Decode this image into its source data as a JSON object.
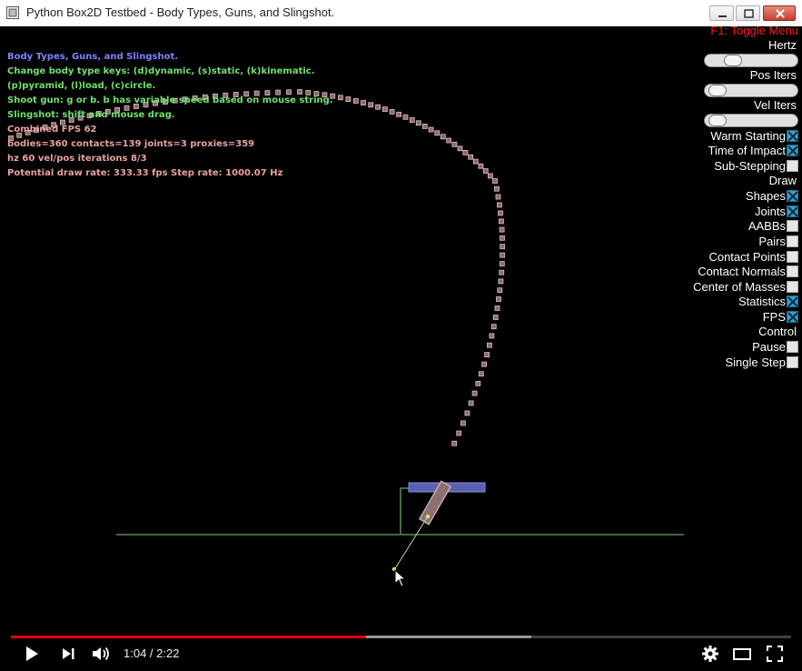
{
  "window": {
    "title": "Python Box2D Testbed - Body Types, Guns, and Slingshot."
  },
  "info": {
    "lines": [
      {
        "text": "Body Types, Guns, and Slingshot.",
        "color": "blue"
      },
      {
        "text": "Change body type keys: (d)dynamic, (s)static, (k)kinematic.",
        "color": "green"
      },
      {
        "text": "(p)pyramid, (l)load, (c)circle.",
        "color": "green"
      },
      {
        "text": "Shoot gun: g or b. b has variable speed based on mouse string.",
        "color": "green"
      },
      {
        "text": "Slingshot: shift and mouse drag.",
        "color": "green"
      },
      {
        "text": "Combined FPS 62",
        "color": "pink"
      },
      {
        "text": "bodies=360 contacts=139 joints=3 proxies=359",
        "color": "pink"
      },
      {
        "text": "hz 60 vel/pos iterations 8/3",
        "color": "pink"
      },
      {
        "text": "Potential draw rate: 333.33 fps Step rate: 1000.07 Hz",
        "color": "pink"
      }
    ]
  },
  "menu": {
    "toggle_label": "F1: Toggle Menu",
    "sliders": [
      {
        "label": "Hertz",
        "value": 0.25
      },
      {
        "label": "Pos Iters",
        "value": 0.05
      },
      {
        "label": "Vel Iters",
        "value": 0.05
      }
    ],
    "options": [
      {
        "label": "Warm Starting",
        "checked": true
      },
      {
        "label": "Time of Impact",
        "checked": true
      },
      {
        "label": "Sub-Stepping",
        "checked": false
      }
    ],
    "draw_header": "Draw",
    "draw_options": [
      {
        "label": "Shapes",
        "checked": true
      },
      {
        "label": "Joints",
        "checked": true
      },
      {
        "label": "AABBs",
        "checked": false
      },
      {
        "label": "Pairs",
        "checked": false
      },
      {
        "label": "Contact Points",
        "checked": false
      },
      {
        "label": "Contact Normals",
        "checked": false
      },
      {
        "label": "Center of Masses",
        "checked": false
      },
      {
        "label": "Statistics",
        "checked": true
      },
      {
        "label": "FPS",
        "checked": true
      }
    ],
    "control_header": "Control",
    "control_options": [
      {
        "label": "Pause",
        "checked": false
      },
      {
        "label": "Single Step",
        "checked": false
      }
    ]
  },
  "player": {
    "current_time": "1:04",
    "duration": "2:22",
    "time_display": "1:04 / 2:22",
    "played_fraction": 0.455,
    "buffered_fraction": 0.667
  },
  "colors": {
    "menu_title": "#ff1a1a",
    "info_blue": "#8080ff",
    "info_green": "#70e070",
    "info_pink": "#e8a0a0",
    "progress": "#ee0000"
  }
}
